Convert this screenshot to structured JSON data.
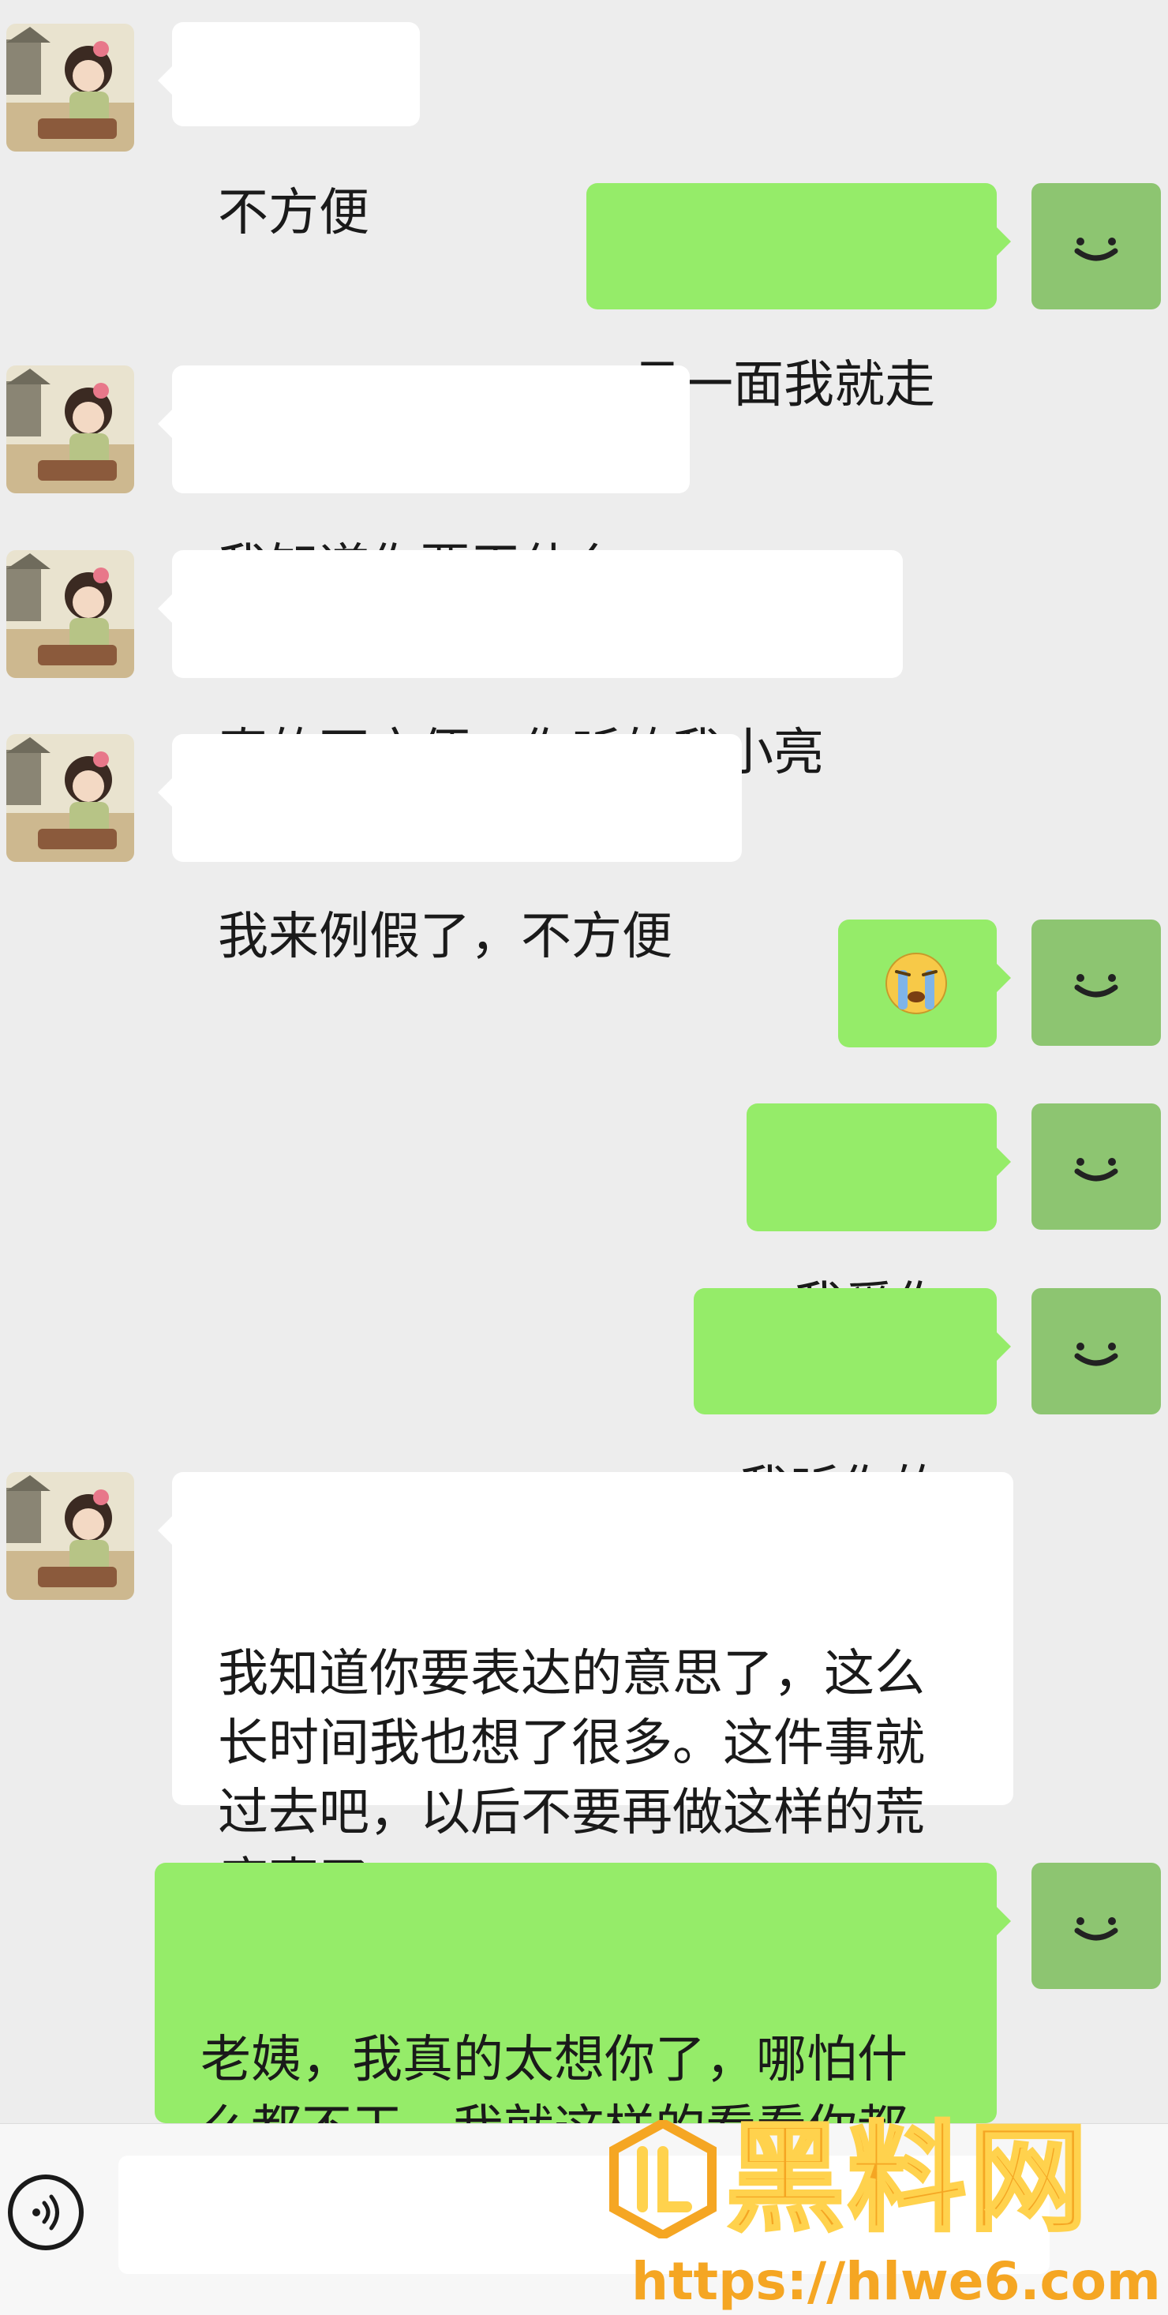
{
  "colors": {
    "background": "#ededed",
    "incoming_bubble": "#ffffff",
    "outgoing_bubble": "#95ec69",
    "self_avatar": "#8dc571",
    "watermark": "#f5a623"
  },
  "messages": [
    {
      "side": "left",
      "text": "不方便"
    },
    {
      "side": "right",
      "text": "见一面我就走"
    },
    {
      "side": "left",
      "text": "我知道你要干什么"
    },
    {
      "side": "left",
      "text": "真的不方便，你听的我小亮"
    },
    {
      "side": "left",
      "text": "我来例假了，不方便"
    },
    {
      "side": "right",
      "emoji": "crying-face-emoji"
    },
    {
      "side": "right",
      "text": "我爱你"
    },
    {
      "side": "right",
      "text": "我听你的"
    },
    {
      "side": "left",
      "text": "我知道你要表达的意思了，这么\n长时间我也想了很多。这件事就\n过去吧，以后不要再做这样的荒\n唐事了"
    },
    {
      "side": "right",
      "text": "老姨，我真的太想你了，哪怕什\n么都不干，我就这样的看看你都\n行"
    }
  ],
  "input_bar": {
    "voice_icon": "voice-icon",
    "input_value": ""
  },
  "watermark": {
    "title": "黑料网",
    "url": "https://hlwe6.com"
  }
}
